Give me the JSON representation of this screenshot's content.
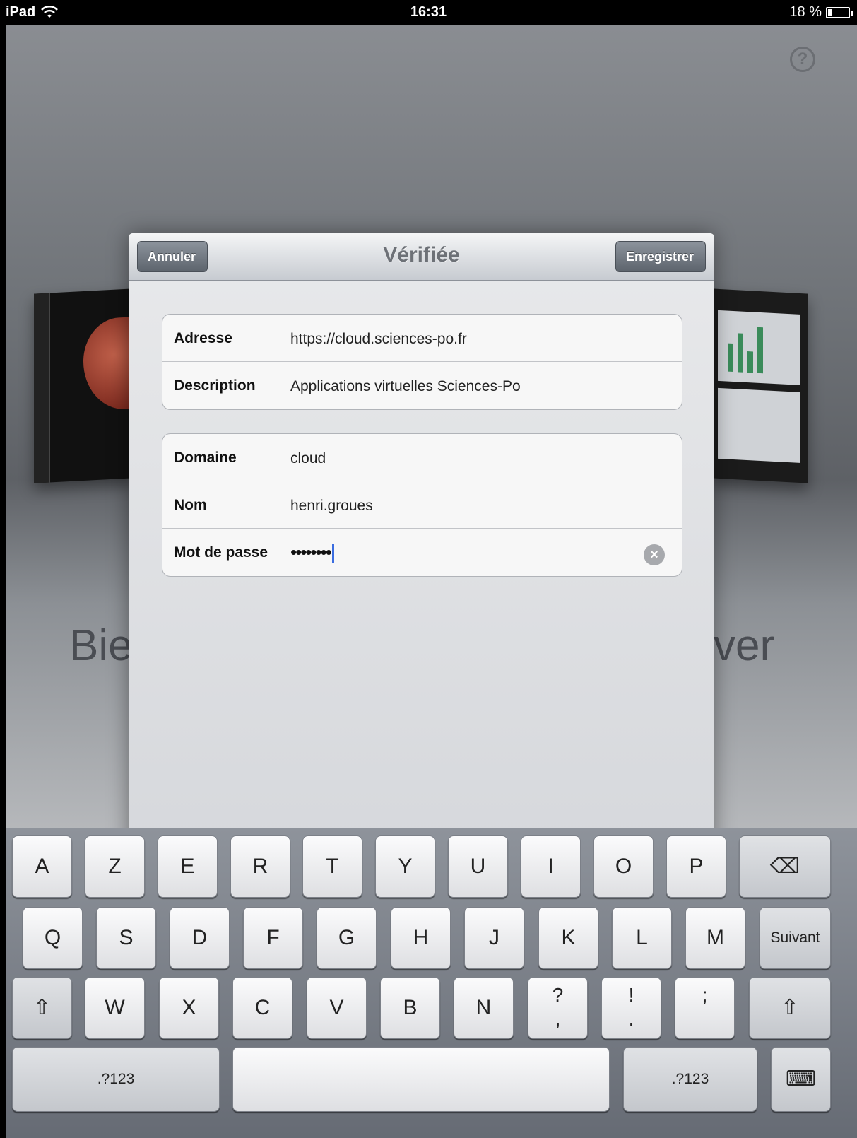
{
  "status_bar": {
    "device": "iPad",
    "time": "16:31",
    "battery": "18 %",
    "battery_level": 0.18
  },
  "background": {
    "welcome_left": "Bie",
    "welcome_right": "ver",
    "help": "?"
  },
  "dialog": {
    "title": "Vérifiée",
    "cancel_label": "Annuler",
    "save_label": "Enregistrer",
    "group1": [
      {
        "label": "Adresse",
        "value": "https://cloud.sciences-po.fr"
      },
      {
        "label": "Description",
        "value": "Applications virtuelles Sciences-Po"
      }
    ],
    "group2": [
      {
        "label": "Domaine",
        "value": "cloud"
      },
      {
        "label": "Nom",
        "value": "henri.groues"
      },
      {
        "label": "Mot de passe",
        "value": "••••••••"
      }
    ]
  },
  "keyboard": {
    "row1": [
      "A",
      "Z",
      "E",
      "R",
      "T",
      "Y",
      "U",
      "I",
      "O",
      "P"
    ],
    "row2": [
      "Q",
      "S",
      "D",
      "F",
      "G",
      "H",
      "J",
      "K",
      "L",
      "M"
    ],
    "row3": [
      "W",
      "X",
      "C",
      "V",
      "B",
      "N"
    ],
    "punct": [
      {
        "top": "?",
        "bottom": ","
      },
      {
        "top": "!",
        "bottom": "."
      },
      {
        "top": ";",
        "bottom": ""
      }
    ],
    "next_label": "Suivant",
    "numbers_label": ".?123",
    "backspace_icon": "⌫",
    "shift_icon": "⇧",
    "dismiss_icon": "⌨"
  }
}
